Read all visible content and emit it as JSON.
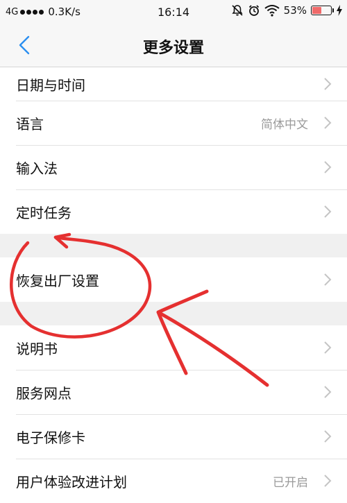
{
  "status_bar": {
    "network": "4G",
    "speed": "0.3K/s",
    "time": "16:14",
    "battery": "53%",
    "battery_level": 0.53,
    "icons": [
      "signal-dots-icon",
      "mute-icon",
      "alarm-icon",
      "wifi-icon",
      "battery-icon",
      "charging-icon"
    ]
  },
  "nav": {
    "title": "更多设置",
    "back_icon": "chevron-left-icon"
  },
  "settings": {
    "group1": [
      {
        "label": "日期与时间",
        "value": ""
      },
      {
        "label": "语言",
        "value": "简体中文"
      },
      {
        "label": "输入法",
        "value": ""
      },
      {
        "label": "定时任务",
        "value": ""
      }
    ],
    "group2": [
      {
        "label": "恢复出厂设置",
        "value": ""
      }
    ],
    "group3": [
      {
        "label": "说明书",
        "value": ""
      },
      {
        "label": "服务网点",
        "value": ""
      },
      {
        "label": "电子保修卡",
        "value": ""
      },
      {
        "label": "用户体验改进计划",
        "value": "已开启"
      }
    ]
  },
  "colors": {
    "accent": "#2b8ff0",
    "annotation": "#e53030",
    "battery_fill": "#f06a6a"
  }
}
